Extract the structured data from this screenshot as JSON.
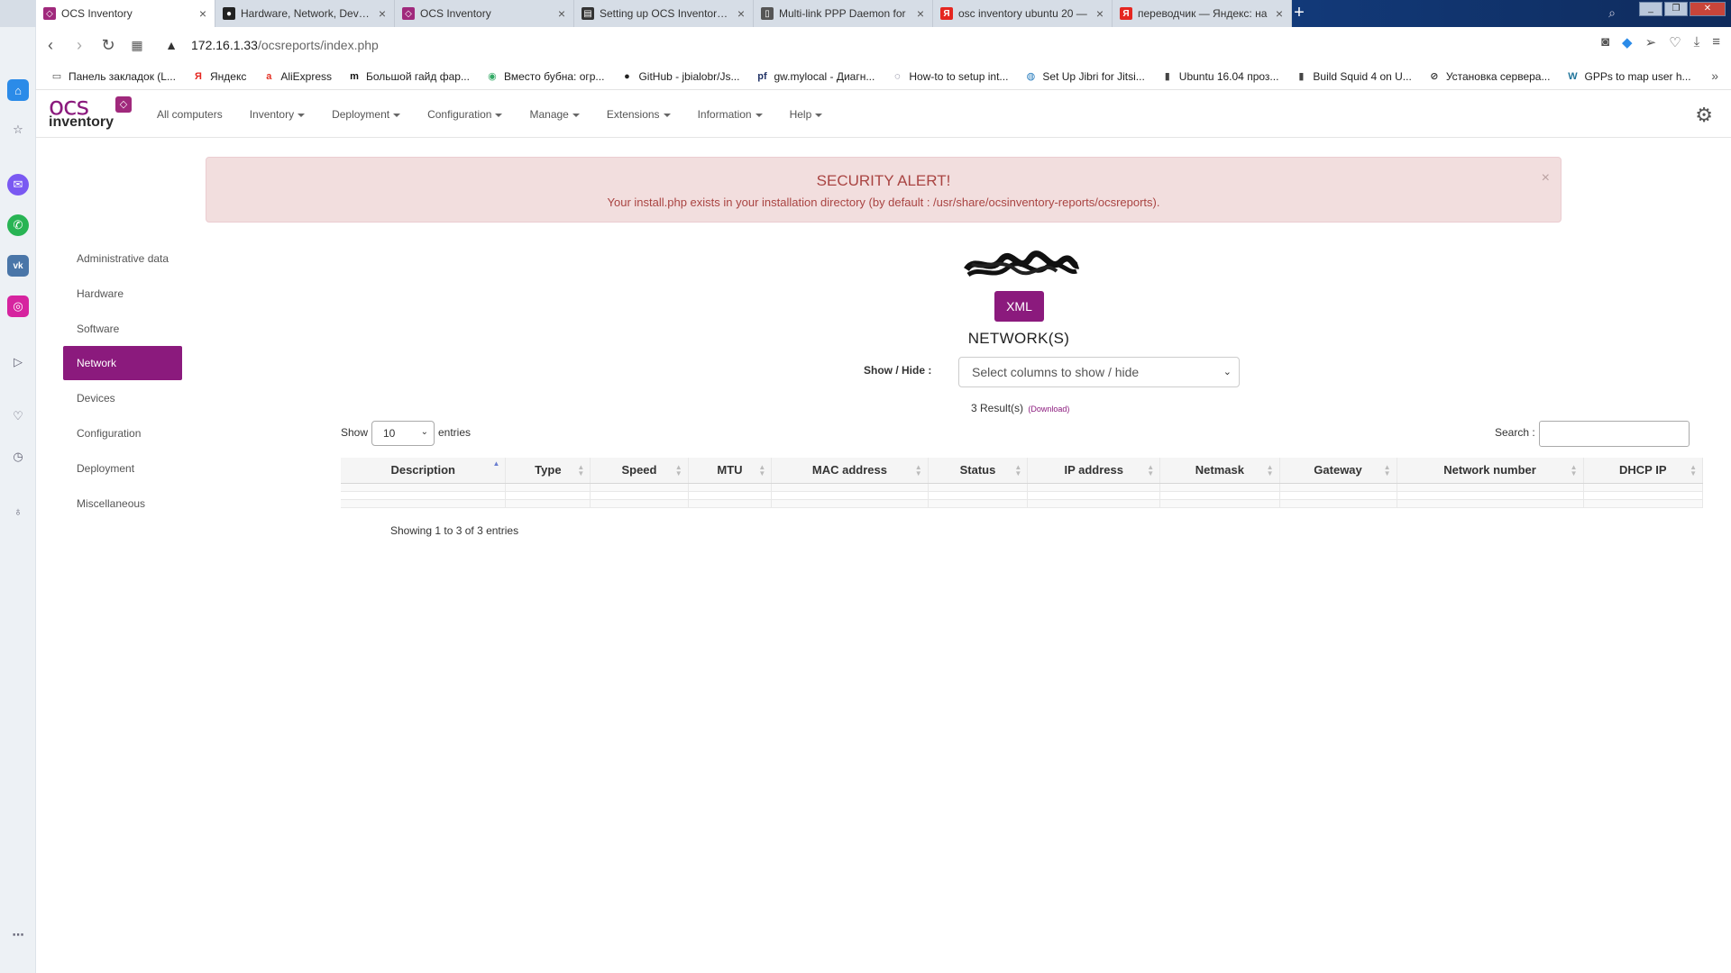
{
  "browser": {
    "tabs": [
      {
        "title": "OCS Inventory",
        "active": true,
        "icon": "ocs-favicon",
        "color": "#a0297c"
      },
      {
        "title": "Hardware, Network, Device",
        "active": false,
        "icon": "github-favicon",
        "color": "#222222"
      },
      {
        "title": "OCS Inventory",
        "active": false,
        "icon": "ocs-favicon",
        "color": "#a0297c"
      },
      {
        "title": "Setting up OCS Inventory S",
        "active": false,
        "icon": "book-favicon",
        "color": "#333333"
      },
      {
        "title": "Multi-link PPP Daemon for",
        "active": false,
        "icon": "page-favicon",
        "color": "#555555"
      },
      {
        "title": "osc inventory ubuntu 20 —",
        "active": false,
        "icon": "yandex-favicon",
        "color": "#e52620"
      },
      {
        "title": "переводчик — Яндекс: на",
        "active": false,
        "icon": "yandex-favicon",
        "color": "#e52620"
      }
    ],
    "url_host": "172.16.1.33",
    "url_path": "/ocsreports/index.php",
    "bookmarks": [
      {
        "label": "Панель закладок (L...",
        "icon": "folder-icon"
      },
      {
        "label": "Яндекс",
        "icon": "yandex-icon"
      },
      {
        "label": "AliExpress",
        "icon": "aliexpress-icon"
      },
      {
        "label": "Большой гайд фар...",
        "icon": "m-icon"
      },
      {
        "label": "Вместо бубна: огр...",
        "icon": "globe-icon"
      },
      {
        "label": "GitHub - jbialobr/Js...",
        "icon": "github-icon"
      },
      {
        "label": "gw.mylocal - Диагн...",
        "icon": "pf-icon"
      },
      {
        "label": "How-to to setup int...",
        "icon": "circle-icon"
      },
      {
        "label": "Set Up Jibri for Jitsi...",
        "icon": "jitsi-icon"
      },
      {
        "label": "Ubuntu 16.04 проз...",
        "icon": "page-icon"
      },
      {
        "label": "Build Squid 4 on U...",
        "icon": "page-icon"
      },
      {
        "label": "Установка сервера...",
        "icon": "noentry-icon"
      },
      {
        "label": "GPPs to map user h...",
        "icon": "wordpress-icon"
      }
    ]
  },
  "app": {
    "menu": [
      {
        "label": "All computers",
        "dropdown": false
      },
      {
        "label": "Inventory",
        "dropdown": true
      },
      {
        "label": "Deployment",
        "dropdown": true
      },
      {
        "label": "Configuration",
        "dropdown": true
      },
      {
        "label": "Manage",
        "dropdown": true
      },
      {
        "label": "Extensions",
        "dropdown": true
      },
      {
        "label": "Information",
        "dropdown": true
      },
      {
        "label": "Help",
        "dropdown": true
      }
    ],
    "alert": {
      "title": "SECURITY ALERT!",
      "message": "Your install.php exists in your installation directory (by default : /usr/share/ocsinventory-reports/ocsreports).",
      "close": "×"
    },
    "leftnav": [
      {
        "label": "Administrative data",
        "active": false
      },
      {
        "label": "Hardware",
        "active": false
      },
      {
        "label": "Software",
        "active": false
      },
      {
        "label": "Network",
        "active": true
      },
      {
        "label": "Devices",
        "active": false
      },
      {
        "label": "Configuration",
        "active": false
      },
      {
        "label": "Deployment",
        "active": false
      },
      {
        "label": "Miscellaneous",
        "active": false
      }
    ],
    "xml_button": "XML",
    "section_title": "NETWORK(S)",
    "showhide_label": "Show / Hide :",
    "showhide_placeholder": "Select columns to show / hide",
    "results_text": "3 Result(s)",
    "download_text": "(Download)",
    "length_label": "Show",
    "length_value": "10",
    "length_suffix": "entries",
    "search_label": "Search :",
    "search_value": "",
    "table": {
      "columns": [
        "Description",
        "Type",
        "Speed",
        "MTU",
        "MAC address",
        "Status",
        "IP address",
        "Netmask",
        "Gateway",
        "Network number",
        "DHCP IP"
      ],
      "sorted_column": 0,
      "rows": [
        [
          "",
          "",
          "",
          "",
          "",
          "",
          "",
          "",
          "",
          "",
          ""
        ],
        [
          "",
          "",
          "",
          "",
          "",
          "",
          "",
          "",
          "",
          "",
          ""
        ],
        [
          "",
          "",
          "",
          "",
          "",
          "",
          "",
          "",
          "",
          "",
          ""
        ]
      ]
    },
    "info_text": "Showing 1 to 3 of 3 entries",
    "brand_color": "#8b1a7d",
    "alert_bg": "#f2dede",
    "alert_text_color": "#a94442"
  }
}
